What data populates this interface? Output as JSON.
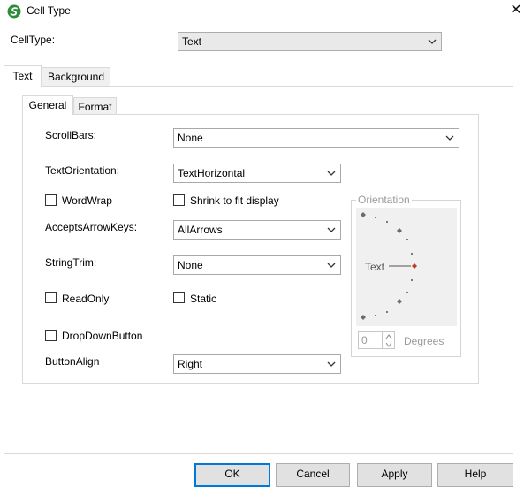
{
  "window": {
    "title": "Cell Type",
    "close_glyph": "✕"
  },
  "celltype": {
    "label": "CellType:",
    "value": "Text"
  },
  "tabs": [
    {
      "label": "Text"
    },
    {
      "label": "Background"
    }
  ],
  "subtabs": [
    {
      "label": "General"
    },
    {
      "label": "Format"
    }
  ],
  "general": {
    "scrollbars": {
      "label": "ScrollBars:",
      "value": "None"
    },
    "text_orientation": {
      "label": "TextOrientation:",
      "value": "TextHorizontal"
    },
    "wordwrap": {
      "label": "WordWrap",
      "checked": false
    },
    "shrink": {
      "label": "Shrink to fit display",
      "checked": false
    },
    "accepts_arrow_keys": {
      "label": "AcceptsArrowKeys:",
      "value": "AllArrows"
    },
    "string_trim": {
      "label": "StringTrim:",
      "value": "None"
    },
    "readonly": {
      "label": "ReadOnly",
      "checked": false
    },
    "static": {
      "label": "Static",
      "checked": false
    },
    "dropdown_button": {
      "label": "DropDownButton",
      "checked": false
    },
    "button_align": {
      "label": "ButtonAlign",
      "value": "Right"
    }
  },
  "orientation": {
    "legend": "Orientation",
    "text_label": "Text",
    "degrees_value": "0",
    "degrees_label": "Degrees"
  },
  "buttons": {
    "ok": "OK",
    "cancel": "Cancel",
    "apply": "Apply",
    "help": "Help"
  },
  "colors": {
    "accent": "#0078d7",
    "brand_green": "#2e8b3a",
    "marker_active": "#c0392b",
    "marker_inactive": "#6b6b6b"
  },
  "icons": {
    "app": "app-logo-icon",
    "close": "close-icon",
    "dropdown": "chevron-down-icon",
    "spin_up": "spin-up-icon",
    "spin_down": "spin-down-icon"
  }
}
